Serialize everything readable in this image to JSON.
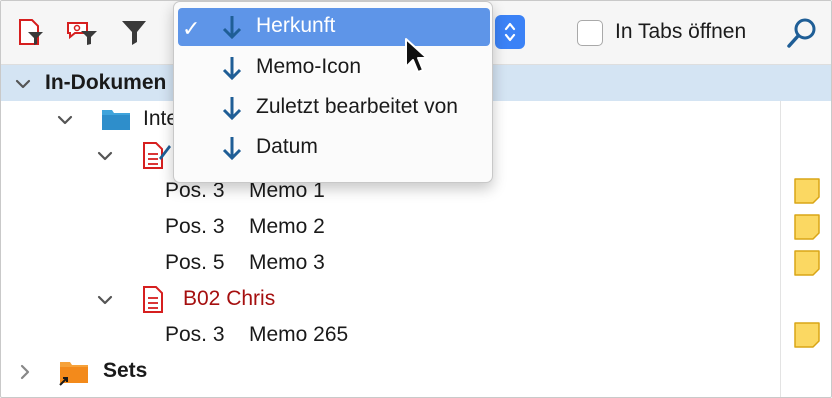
{
  "toolbar": {
    "checkbox_label": "In Tabs öffnen",
    "checkbox_checked": false,
    "icons": [
      "document-filter-icon",
      "memo-filter-icon",
      "filter-icon",
      "search-icon"
    ]
  },
  "dropdown": {
    "items": [
      {
        "label": "Herkunft",
        "checked": true,
        "icon": "sort-down-arrow-icon"
      },
      {
        "label": "Memo-Icon",
        "checked": false,
        "icon": "sort-down-arrow-icon"
      },
      {
        "label": "Zuletzt bearbeitet von",
        "checked": false,
        "icon": "sort-down-arrow-icon"
      },
      {
        "label": "Datum",
        "checked": false,
        "icon": "sort-down-arrow-icon"
      }
    ]
  },
  "tree": {
    "root_label": "In-Dokumen",
    "folder_label": "Inte",
    "doc_group_1": {
      "items": [
        {
          "pos": "Pos. 3",
          "memo": "Memo 1"
        },
        {
          "pos": "Pos. 3",
          "memo": "Memo 2"
        },
        {
          "pos": "Pos. 5",
          "memo": "Memo 3"
        }
      ]
    },
    "doc_group_2": {
      "label": "B02 Chris",
      "items": [
        {
          "pos": "Pos. 3",
          "memo": "Memo 265"
        }
      ]
    },
    "sets_label": "Sets"
  },
  "colors": {
    "accent": "#3b82f6",
    "selection": "#d4e4f3",
    "menu_highlight": "#5e95e8",
    "doc_red": "#a50f0f",
    "memo_yellow": "#fbd862",
    "arrow_blue": "#1f5e96"
  }
}
